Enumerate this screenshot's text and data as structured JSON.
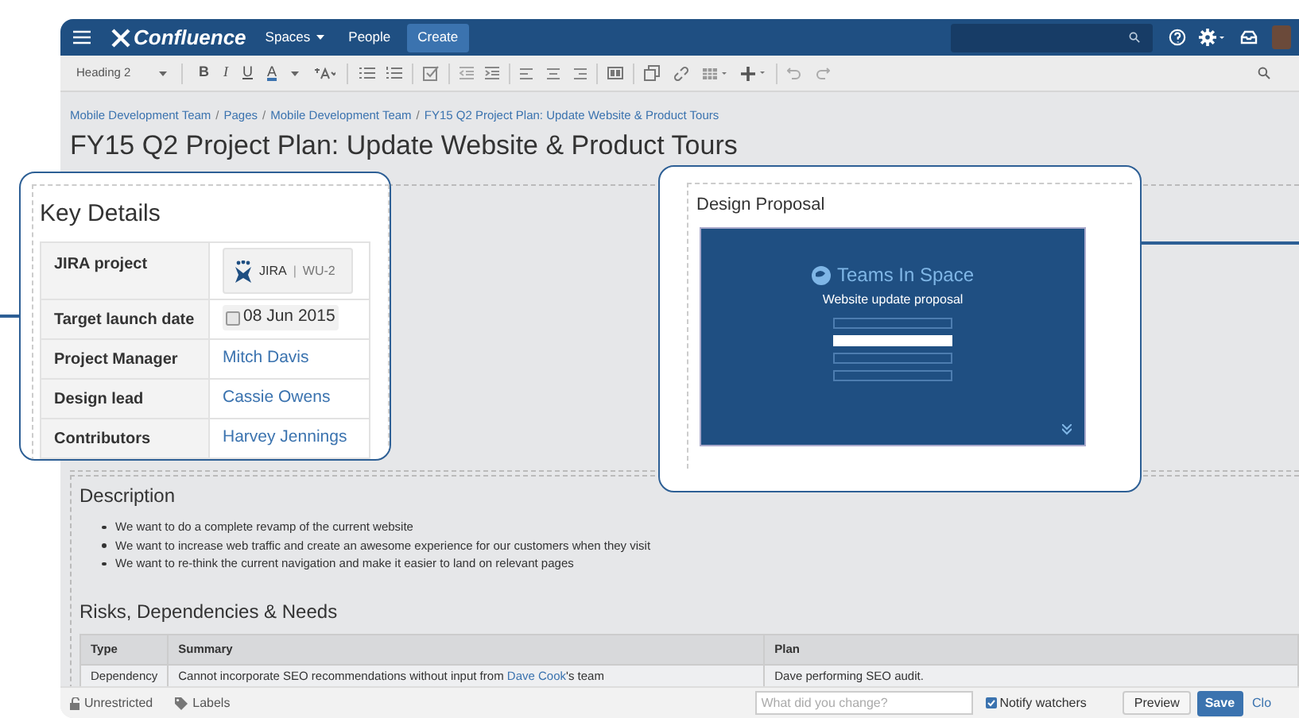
{
  "nav": {
    "brand": "Confluence",
    "menu": [
      {
        "label": "Spaces",
        "dropdown": true
      },
      {
        "label": "People",
        "dropdown": false
      }
    ],
    "create": "Create"
  },
  "toolbar": {
    "style": "Heading 2",
    "format": [
      "B",
      "I",
      "U",
      "A"
    ]
  },
  "breadcrumbs": [
    {
      "kind": "link",
      "text": "Mobile Development Team"
    },
    {
      "kind": "separator",
      "text": "/"
    },
    {
      "kind": "link",
      "text": "Pages"
    },
    {
      "kind": "separator",
      "text": "/"
    },
    {
      "kind": "link",
      "text": "Mobile Development Team"
    },
    {
      "kind": "separator",
      "text": "/"
    },
    {
      "kind": "link",
      "text": "FY15 Q2 Project Plan: Update Website & Product Tours"
    }
  ],
  "title": "FY15 Q2 Project Plan: Update Website & Product Tours",
  "key_details": {
    "heading": "Key Details",
    "rows": [
      {
        "label": "JIRA project",
        "kind": "jira",
        "value": "JIRA",
        "divider": "|",
        "issue": "WU-2"
      },
      {
        "label": "Target launch date",
        "kind": "date",
        "value": "08 Jun 2015"
      },
      {
        "label": "Project Manager",
        "kind": "user",
        "value": "Mitch Davis"
      },
      {
        "label": "Design lead",
        "kind": "user",
        "value": "Cassie Owens"
      },
      {
        "label": "Contributors",
        "kind": "user",
        "value": "Harvey Jennings"
      }
    ]
  },
  "design_proposal": {
    "heading": "Design Proposal",
    "mockup": {
      "brand": "Teams In Space",
      "title": "Website update proposal",
      "buttons": [
        {
          "selected": false
        },
        {
          "selected": true
        },
        {
          "selected": false
        },
        {
          "selected": false
        }
      ]
    }
  },
  "description": {
    "heading": "Description",
    "bullets": [
      "We want to do a complete revamp of the current website",
      "We want to increase web traffic and create an awesome experience for our customers when they visit",
      "We want to re-think the current navigation and make it easier to land on relevant pages"
    ]
  },
  "risks": {
    "heading": "Risks, Dependencies & Needs",
    "columns": [
      "Type",
      "Summary",
      "Plan"
    ],
    "rows": [
      {
        "type": "Dependency",
        "summary": [
          {
            "text": "Cannot incorporate SEO recommendations without input from ",
            "link": false
          },
          {
            "text": "Dave Cook",
            "link": true
          },
          {
            "text": "'s team",
            "link": false
          }
        ],
        "plan": "Dave performing SEO audit."
      }
    ]
  },
  "footer": {
    "restrictions": "Unrestricted",
    "labels": "Labels",
    "comment_placeholder": "What did you change?",
    "notify": {
      "label": "Notify watchers",
      "checked": true
    },
    "preview": "Preview",
    "save": "Save",
    "close": "Clo"
  }
}
